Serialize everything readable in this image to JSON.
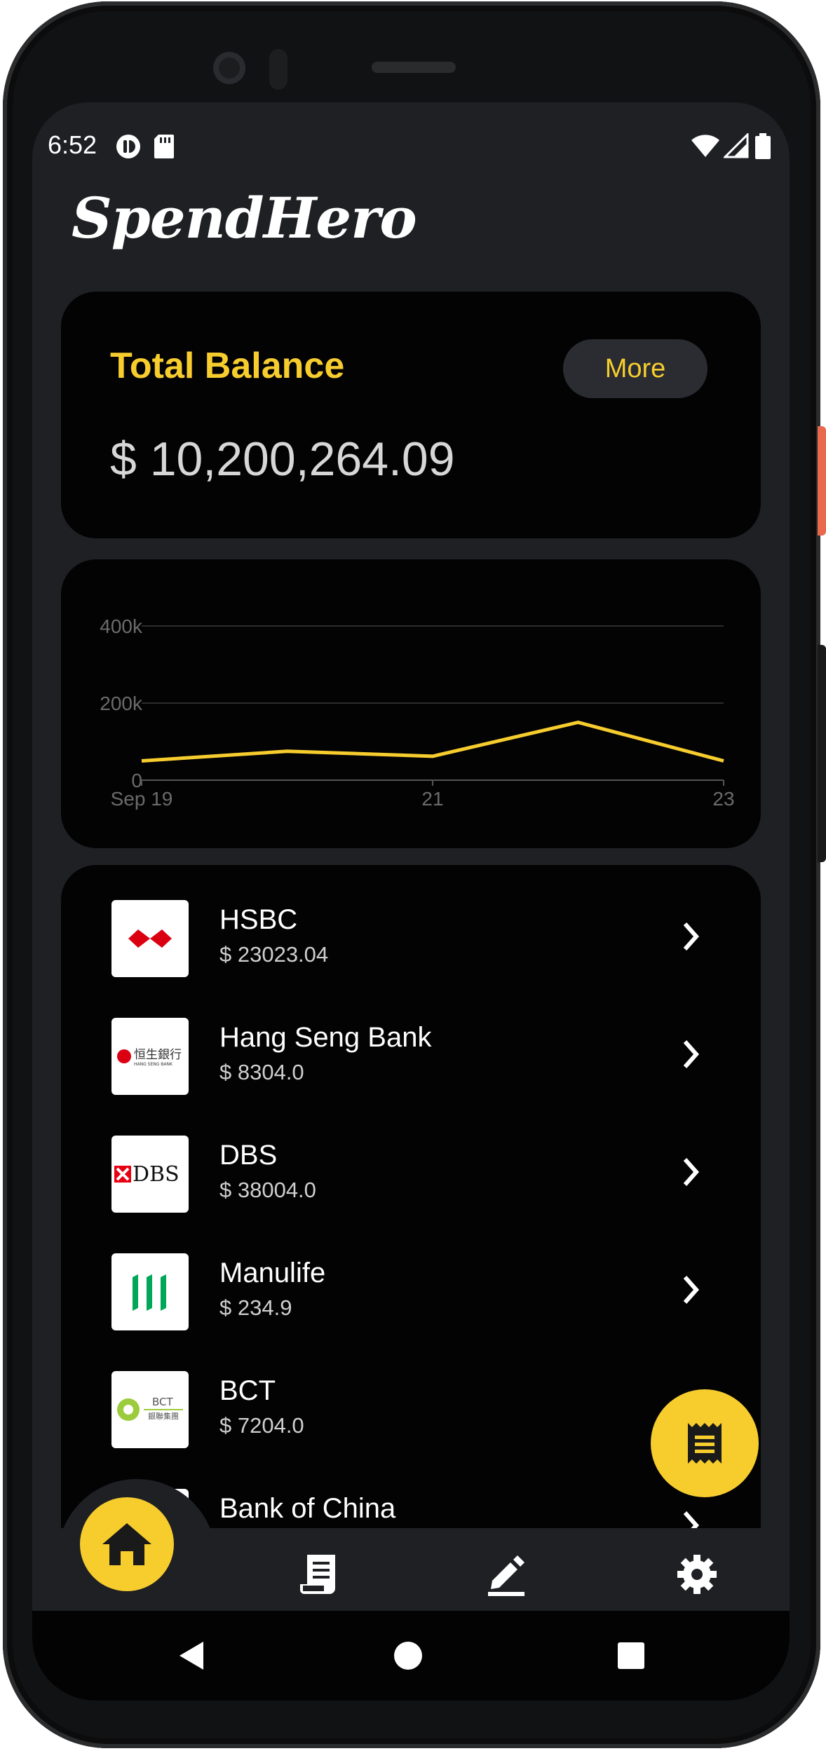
{
  "status_bar": {
    "time": "6:52",
    "icons": [
      "cloud-app-icon",
      "sd-card-icon",
      "wifi-icon",
      "signal-icon",
      "battery-icon"
    ]
  },
  "app": {
    "title": "SpendHero"
  },
  "balance": {
    "label": "Total Balance",
    "more_label": "More",
    "amount": "$ 10,200,264.09"
  },
  "chart_data": {
    "type": "line",
    "x": [
      "Sep 19",
      "Sep 20",
      "Sep 21",
      "Sep 22",
      "Sep 23"
    ],
    "x_tick_labels": [
      "Sep 19",
      "21",
      "23"
    ],
    "series": [
      {
        "values": [
          50000,
          75000,
          62000,
          150000,
          50000
        ]
      }
    ],
    "y_tick_labels": [
      "0",
      "200k",
      "400k"
    ],
    "ylim": [
      0,
      400000
    ],
    "grid": true,
    "color": "#f7cd2e"
  },
  "accounts": [
    {
      "name": "HSBC",
      "balance": "$ 23023.04",
      "logo": "hsbc-logo"
    },
    {
      "name": "Hang Seng Bank",
      "balance": "$ 8304.0",
      "logo": "hang-seng-logo",
      "logo_text": "恒生銀行",
      "logo_subtext": "HANG SENG BANK"
    },
    {
      "name": "DBS",
      "balance": "$ 38004.0",
      "logo": "dbs-logo",
      "logo_text": "DBS"
    },
    {
      "name": "Manulife",
      "balance": "$ 234.9",
      "logo": "manulife-logo"
    },
    {
      "name": "BCT",
      "balance": "$ 7204.0",
      "logo": "bct-logo",
      "logo_text": "BCT",
      "logo_subtext": "銀聯集團"
    },
    {
      "name": "Bank of China",
      "balance": "",
      "logo": "boc-logo"
    }
  ],
  "nav": [
    "home-icon",
    "receipt-icon",
    "edit-icon",
    "settings-icon"
  ],
  "colors": {
    "accent": "#f7cd2e",
    "background": "#1e2024",
    "card": "#030304"
  }
}
